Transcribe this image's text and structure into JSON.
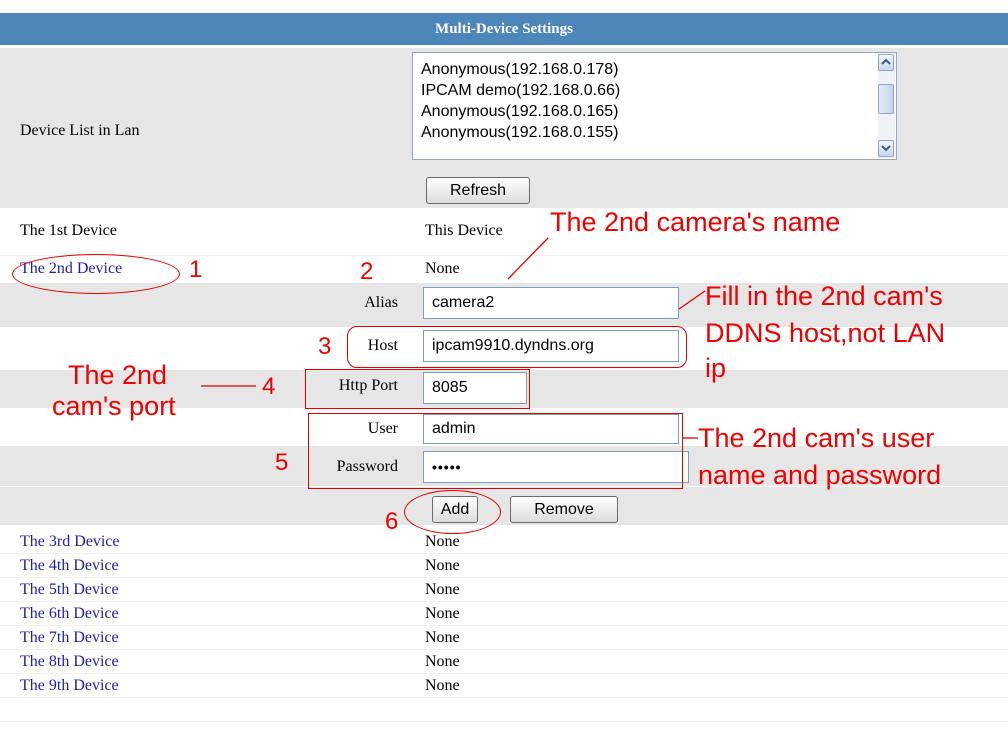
{
  "title": "Multi-Device Settings",
  "device_list": {
    "label": "Device List in Lan",
    "items": [
      "Anonymous(192.168.0.178)",
      "IPCAM demo(192.168.0.66)",
      "Anonymous(192.168.0.165)",
      "Anonymous(192.168.0.155)"
    ],
    "refresh_label": "Refresh"
  },
  "first_device": {
    "label": "The 1st Device",
    "value": "This Device"
  },
  "second_device": {
    "label": "The 2nd Device",
    "value": "None",
    "alias_label": "Alias",
    "alias_value": "camera2",
    "host_label": "Host",
    "host_value": "ipcam9910.dyndns.org",
    "port_label": "Http Port",
    "port_value": "8085",
    "user_label": "User",
    "user_value": "admin",
    "password_label": "Password",
    "password_value": "•••••",
    "add_label": "Add",
    "remove_label": "Remove"
  },
  "other_devices": [
    {
      "label": "The 3rd Device",
      "value": "None"
    },
    {
      "label": "The 4th Device",
      "value": "None"
    },
    {
      "label": "The 5th Device",
      "value": "None"
    },
    {
      "label": "The 6th Device",
      "value": "None"
    },
    {
      "label": "The 7th Device",
      "value": "None"
    },
    {
      "label": "The 8th Device",
      "value": "None"
    },
    {
      "label": "The 9th Device",
      "value": "None"
    }
  ],
  "annotations": {
    "camera_name": "The 2nd camera's name",
    "ddns_line1": "Fill in the 2nd cam's",
    "ddns_line2": "DDNS host,not LAN",
    "ddns_line3": "ip",
    "port_line1": "The 2nd",
    "port_line2": "cam's port",
    "user_line1": "The 2nd cam's user",
    "user_line2": "name and password",
    "n1": "1",
    "n2": "2",
    "n3": "3",
    "n4": "4",
    "n5": "5",
    "n6": "6"
  },
  "colors": {
    "header": "#4d86b8",
    "row_gray": "#e6e6e6",
    "link": "#2020a8",
    "annotation": "#ee0000"
  },
  "icons": {
    "scroll_up": "chevron-up-icon",
    "scroll_down": "chevron-down-icon"
  }
}
